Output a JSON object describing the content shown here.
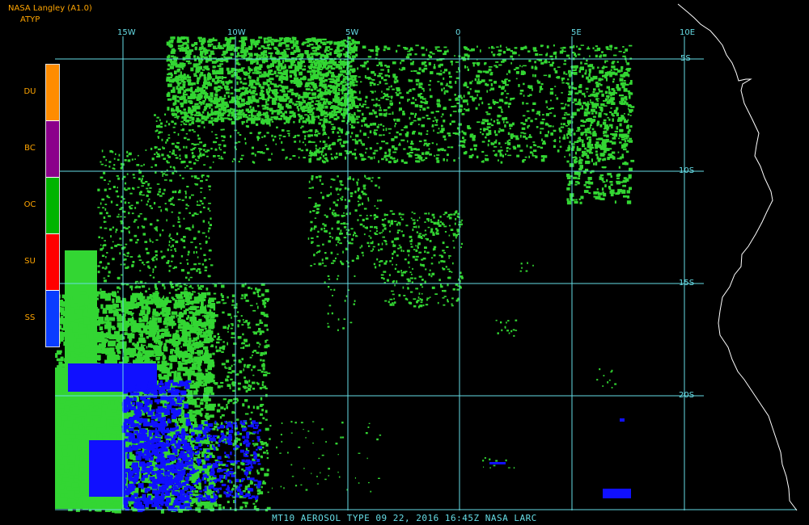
{
  "header": {
    "source": "NASA Langley (A1.0)",
    "product": "ATYP"
  },
  "legend": {
    "items": [
      {
        "label": "DU",
        "color": "#ff8c00"
      },
      {
        "label": "BC",
        "color": "#8b008b"
      },
      {
        "label": "OC",
        "color": "#00b400"
      },
      {
        "label": "SU",
        "color": "#ff0000"
      },
      {
        "label": "SS",
        "color": "#0a3cff"
      }
    ]
  },
  "grid": {
    "lon_labels": [
      "15W",
      "10W",
      "5W",
      "0",
      "5E",
      "10E"
    ],
    "lat_labels": [
      "5S",
      "10S",
      "15S",
      "20S"
    ],
    "color": "#66dde6"
  },
  "map_colors": {
    "organic_carbon": "#33d633",
    "sea_salt": "#1010ff",
    "coastline": "#ffffff"
  },
  "footer": {
    "caption": "MT10  AEROSOL TYPE  09 22, 2016 16:45Z  NASA LARC"
  }
}
